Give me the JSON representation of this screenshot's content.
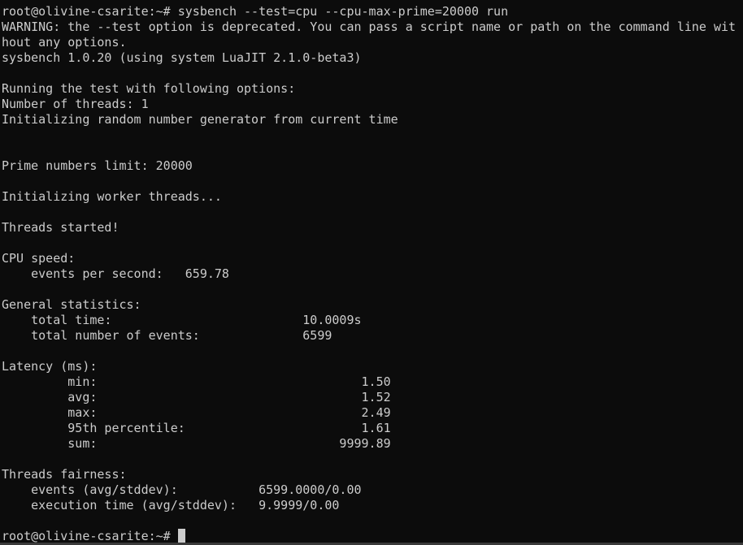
{
  "terminal": {
    "colors": {
      "background": "#0c0c0c",
      "foreground": "#cccccc"
    },
    "lines": [
      "root@olivine-csarite:~# sysbench --test=cpu --cpu-max-prime=20000 run",
      "WARNING: the --test option is deprecated. You can pass a script name or path on the command line wit",
      "hout any options.",
      "sysbench 1.0.20 (using system LuaJIT 2.1.0-beta3)",
      "",
      "Running the test with following options:",
      "Number of threads: 1",
      "Initializing random number generator from current time",
      "",
      "",
      "Prime numbers limit: 20000",
      "",
      "Initializing worker threads...",
      "",
      "Threads started!",
      "",
      "CPU speed:",
      "    events per second:   659.78",
      "",
      "General statistics:",
      "    total time:                          10.0009s",
      "    total number of events:              6599",
      "",
      "Latency (ms):",
      "         min:                                    1.50",
      "         avg:                                    1.52",
      "         max:                                    2.49",
      "         95th percentile:                        1.61",
      "         sum:                                 9999.89",
      "",
      "Threads fairness:",
      "    events (avg/stddev):           6599.0000/0.00",
      "    execution time (avg/stddev):   9.9999/0.00",
      ""
    ],
    "prompt": "root@olivine-csarite:~# "
  }
}
